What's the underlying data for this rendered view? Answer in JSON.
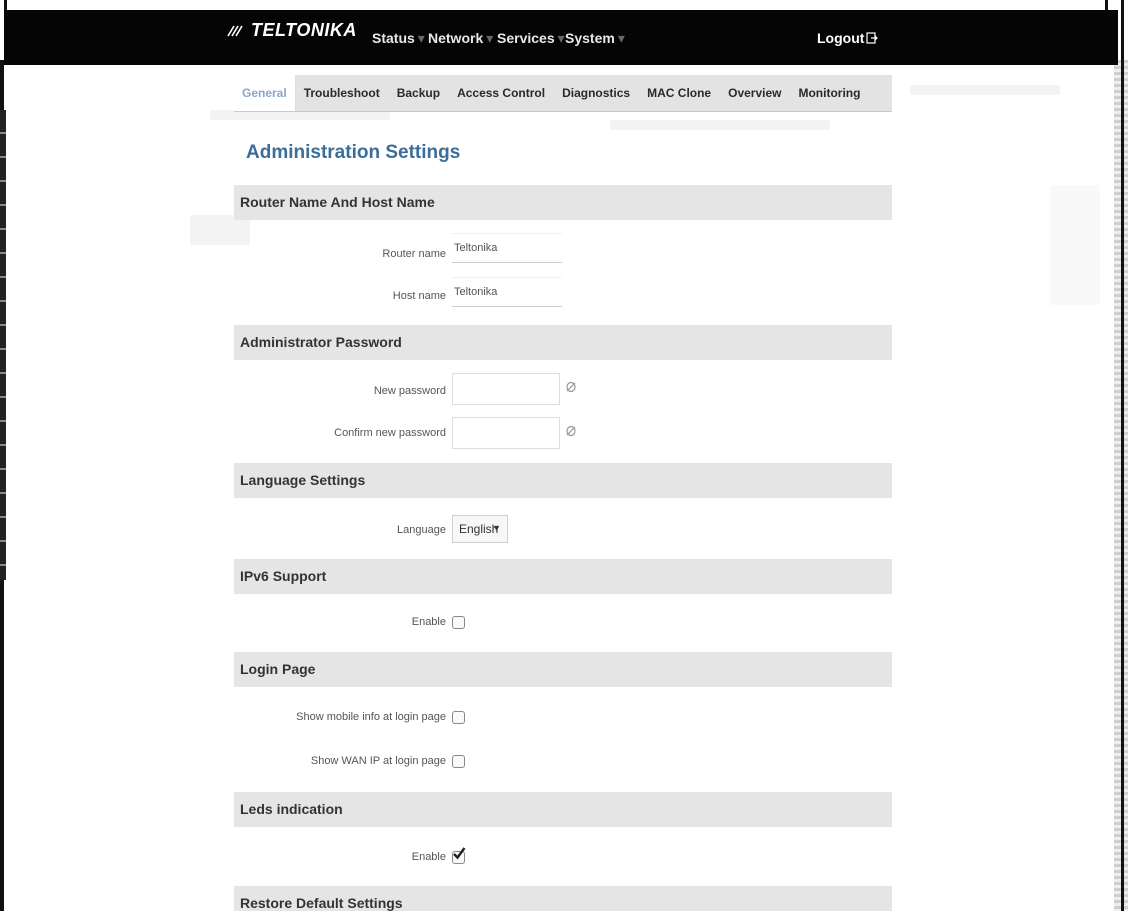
{
  "brand": {
    "name": "TELTONIKA"
  },
  "nav": {
    "items": [
      "Status",
      "Network",
      "Services",
      "System"
    ],
    "logout": "Logout"
  },
  "tabs": [
    "General",
    "Troubleshoot",
    "Backup",
    "Access Control",
    "Diagnostics",
    "MAC Clone",
    "Overview",
    "Monitoring"
  ],
  "active_tab": "General",
  "page_title": "Administration Settings",
  "sections": {
    "router_name": {
      "title": "Router Name And Host Name",
      "router_name_label": "Router name",
      "router_name_value": "Teltonika",
      "host_name_label": "Host name",
      "host_name_value": "Teltonika"
    },
    "password": {
      "title": "Administrator Password",
      "new_label": "New password",
      "confirm_label": "Confirm new password"
    },
    "language": {
      "title": "Language Settings",
      "label": "Language",
      "selected": "English"
    },
    "ipv6": {
      "title": "IPv6 Support",
      "enable_label": "Enable",
      "enabled": false
    },
    "login_page": {
      "title": "Login Page",
      "mobile_info_label": "Show mobile info at login page",
      "mobile_info_checked": false,
      "wan_ip_label": "Show WAN IP at login page",
      "wan_ip_checked": false
    },
    "leds": {
      "title": "Leds indication",
      "enable_label": "Enable",
      "enabled": true
    },
    "restore": {
      "title": "Restore Default Settings"
    }
  },
  "colors": {
    "navbar": "#050505",
    "title": "#3a6d9a",
    "active_tab": "#8aa7c7",
    "section_bg": "#e5e5e5"
  }
}
